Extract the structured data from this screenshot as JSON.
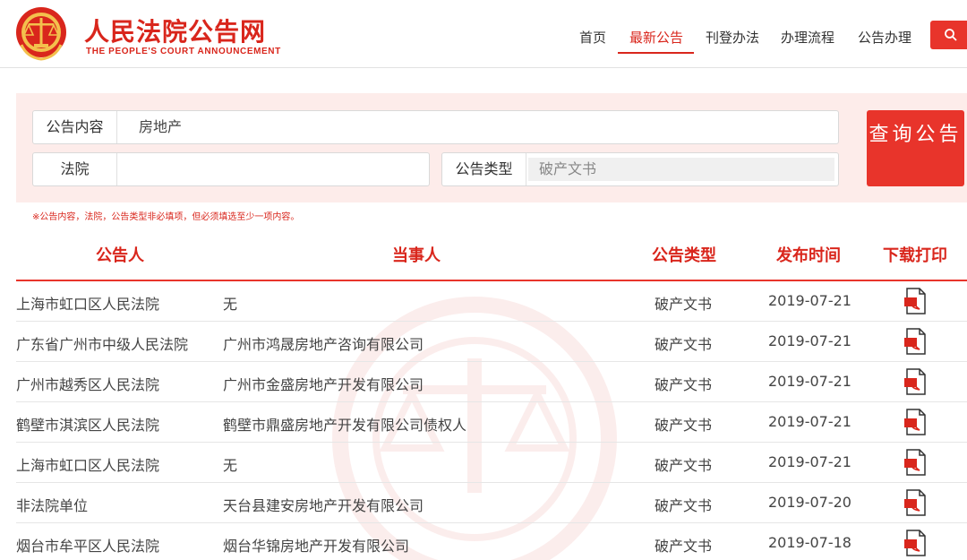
{
  "header": {
    "site_title": "人民法院公告网",
    "site_subtitle": "THE PEOPLE'S COURT ANNOUNCEMENT",
    "nav": [
      {
        "label": "首页",
        "active": false
      },
      {
        "label": "最新公告",
        "active": true
      },
      {
        "label": "刊登办法",
        "active": false
      },
      {
        "label": "办理流程",
        "active": false
      },
      {
        "label": "公告办理",
        "active": false
      }
    ],
    "search_icon": "search-icon"
  },
  "search_form": {
    "content_label": "公告内容",
    "content_value": "房地产",
    "court_label": "法院",
    "court_value": "",
    "type_label": "公告类型",
    "type_value": "破产文书",
    "query_button": "查询公告",
    "note": "※公告内容，法院，公告类型非必填项，但必须填选至少一项内容。"
  },
  "table": {
    "columns": [
      "公告人",
      "当事人",
      "公告类型",
      "发布时间",
      "下载打印"
    ],
    "rows": [
      {
        "announcer": "上海市虹口区人民法院",
        "party": "无",
        "type": "破产文书",
        "date": "2019-07-21"
      },
      {
        "announcer": "广东省广州市中级人民法院",
        "party": "广州市鸿晟房地产咨询有限公司",
        "type": "破产文书",
        "date": "2019-07-21"
      },
      {
        "announcer": "广州市越秀区人民法院",
        "party": "广州市金盛房地产开发有限公司",
        "type": "破产文书",
        "date": "2019-07-21"
      },
      {
        "announcer": "鹤壁市淇滨区人民法院",
        "party": "鹤壁市鼎盛房地产开发有限公司债权人",
        "type": "破产文书",
        "date": "2019-07-21"
      },
      {
        "announcer": "上海市虹口区人民法院",
        "party": "无",
        "type": "破产文书",
        "date": "2019-07-21"
      },
      {
        "announcer": "非法院单位",
        "party": "天台县建安房地产开发有限公司",
        "type": "破产文书",
        "date": "2019-07-20"
      },
      {
        "announcer": "烟台市牟平区人民法院",
        "party": "烟台华锦房地产开发有限公司",
        "type": "破产文书",
        "date": "2019-07-18"
      }
    ]
  },
  "colors": {
    "brand_red": "#d9261c",
    "button_red": "#e8342b",
    "panel_bg": "#fdecea"
  }
}
